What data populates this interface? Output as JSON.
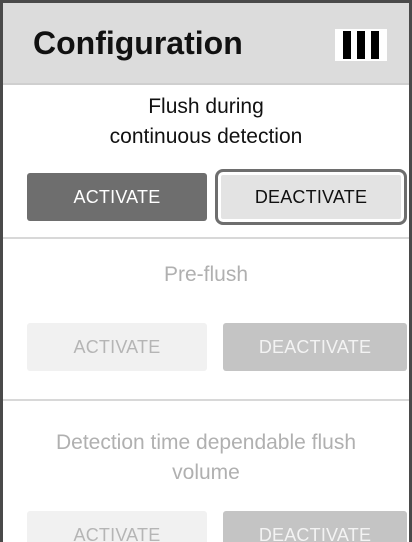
{
  "header": {
    "title": "Configuration"
  },
  "menu_icon": "menu-bars-icon",
  "sections": [
    {
      "title_line1": "Flush during",
      "title_line2": "continuous detection",
      "activate_label": "ACTIVATE",
      "deactivate_label": "DEACTIVATE",
      "selected": "DEACTIVATE",
      "enabled": true
    },
    {
      "title_line1": "Pre-flush",
      "activate_label": "ACTIVATE",
      "deactivate_label": "DEACTIVATE",
      "enabled": false
    },
    {
      "title_line1": "Detection time dependable flush",
      "title_line2": "volume",
      "activate_label": "ACTIVATE",
      "deactivate_label": "DEACTIVATE",
      "enabled": false
    }
  ],
  "colors": {
    "header_bg": "#dcdcdc",
    "active_dark": "#6e6e6e",
    "disabled_light": "#f1f1f1",
    "disabled_mid": "#c4c4c4"
  }
}
